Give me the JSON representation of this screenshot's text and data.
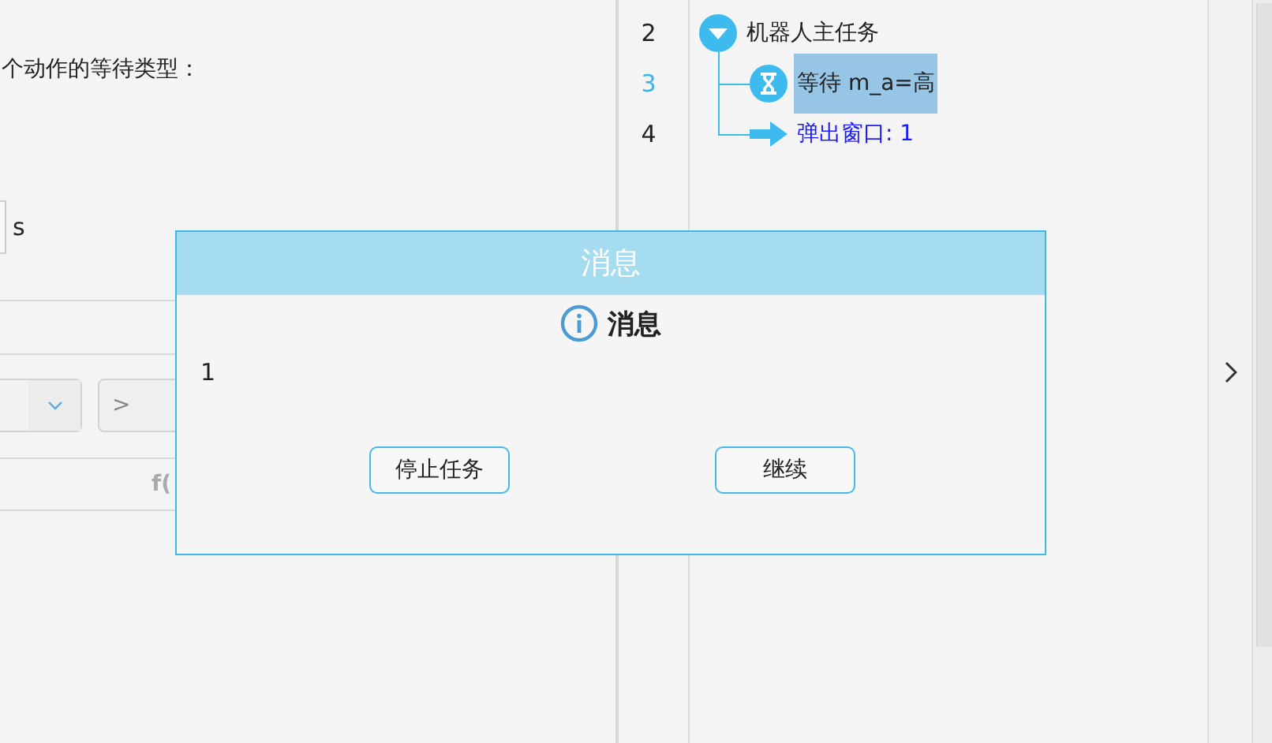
{
  "left_panel": {
    "prompt": "个动作的等待类型：",
    "duration_unit": "s",
    "operator_field": {
      "value": ">"
    },
    "formula_label": "f("
  },
  "tree": {
    "rows": [
      {
        "line": "2",
        "label": "机器人主任务",
        "kind": "task",
        "expanded": true,
        "selected": false,
        "children": [
          {
            "line": "3",
            "label": "等待  m_a=高",
            "kind": "wait",
            "selected": true
          },
          {
            "line": "4",
            "label": "弹出窗口: 1",
            "kind": "popup",
            "selected": false
          }
        ]
      }
    ]
  },
  "dialog": {
    "title": "消息",
    "heading": "消息",
    "message": "1",
    "buttons": [
      "停止任务",
      "继续"
    ]
  }
}
